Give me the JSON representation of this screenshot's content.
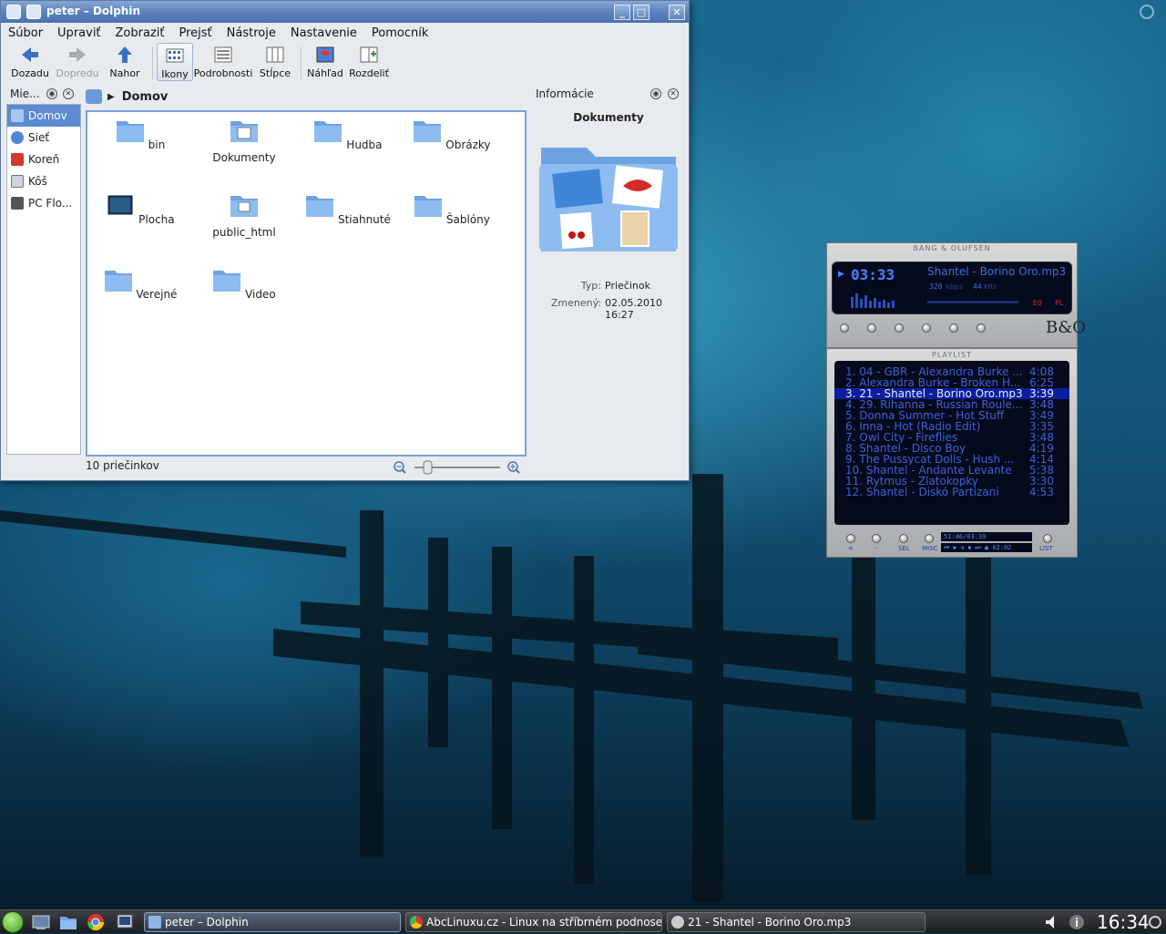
{
  "dolphin": {
    "title": "peter – Dolphin",
    "menu": [
      "Súbor",
      "Upraviť",
      "Zobraziť",
      "Prejsť",
      "Nástroje",
      "Nastavenie",
      "Pomocník"
    ],
    "toolbar": {
      "back": "Dozadu",
      "forward": "Dopredu",
      "up": "Nahor",
      "icons": "Ikony",
      "details": "Podrobnosti",
      "columns": "Stĺpce",
      "preview": "Náhľad",
      "split": "Rozdeliť"
    },
    "places_title": "Mie...",
    "places": [
      "Domov",
      "Sieť",
      "Koreň",
      "Kôš",
      "PC Flo..."
    ],
    "breadcrumb": "Domov",
    "files": [
      "bin",
      "Dokumenty",
      "Hudba",
      "Obrázky",
      "Plocha",
      "public_html",
      "Stiahnuté",
      "Šablóny",
      "Verejné",
      "Video"
    ],
    "info": {
      "title": "Informácie",
      "item": "Dokumenty",
      "type_label": "Typ:",
      "type_value": "Priečinok",
      "modified_label": "Zmenený:",
      "modified_date": "02.05.2010",
      "modified_time": "16:27"
    },
    "status": "10 priečinkov"
  },
  "xmms": {
    "brand": "BANG & OLUFSEN",
    "time": "03:33",
    "song": "Shantel - Borino Oro.mp3",
    "bitrate": "320",
    "bitrate_unit": "kbps",
    "freq": "44",
    "freq_unit": "kHz",
    "eq": "EQ",
    "pl": "PL",
    "logo": "B&O",
    "playlist_title": "PLAYLIST",
    "playlist": [
      {
        "t": "1. 04 - GBR - Alexandra Burke ...",
        "d": "4:08"
      },
      {
        "t": "2. Alexandra Burke - Broken H...",
        "d": "6:25"
      },
      {
        "t": "3. 21 - Shantel - Borino Oro.mp3",
        "d": "3:39"
      },
      {
        "t": "4. 29. Rihanna - Russian Roule...",
        "d": "3:48"
      },
      {
        "t": "5. Donna Summer - Hot Stuff",
        "d": "3:49"
      },
      {
        "t": "6. Inna - Hot  (Radio Edit)",
        "d": "3:35"
      },
      {
        "t": "7. Owl City - Fireflies",
        "d": "3:48"
      },
      {
        "t": "8. Shantel - Disco Boy",
        "d": "4:19"
      },
      {
        "t": "9. The Pussycat Dolls - Hush ...",
        "d": "4:14"
      },
      {
        "t": "10. Shantel - Andante Levante",
        "d": "5:38"
      },
      {
        "t": "11. Rytmus - Zlatokopky",
        "d": "3:30"
      },
      {
        "t": "12. Shantel - Diskó Partizani",
        "d": "4:53"
      }
    ],
    "current_index": 2,
    "pl_buttons": [
      "+",
      "-",
      "SEL",
      "MISC",
      "LIST"
    ],
    "pl_total": "51:46/03:39",
    "pl_elapsed": "02:02"
  },
  "taskbar": {
    "tasks": [
      "peter – Dolphin",
      "AbcLinuxu.cz - Linux na stříbrném podnose",
      "21 - Shantel - Borino Oro.mp3"
    ],
    "clock": "16:34"
  },
  "colors": {
    "titlebar": "#5c82bd",
    "selection": "#5d8ad1",
    "lcd_text": "#3f6fe0",
    "playlist_current": "#0a1fa0"
  }
}
